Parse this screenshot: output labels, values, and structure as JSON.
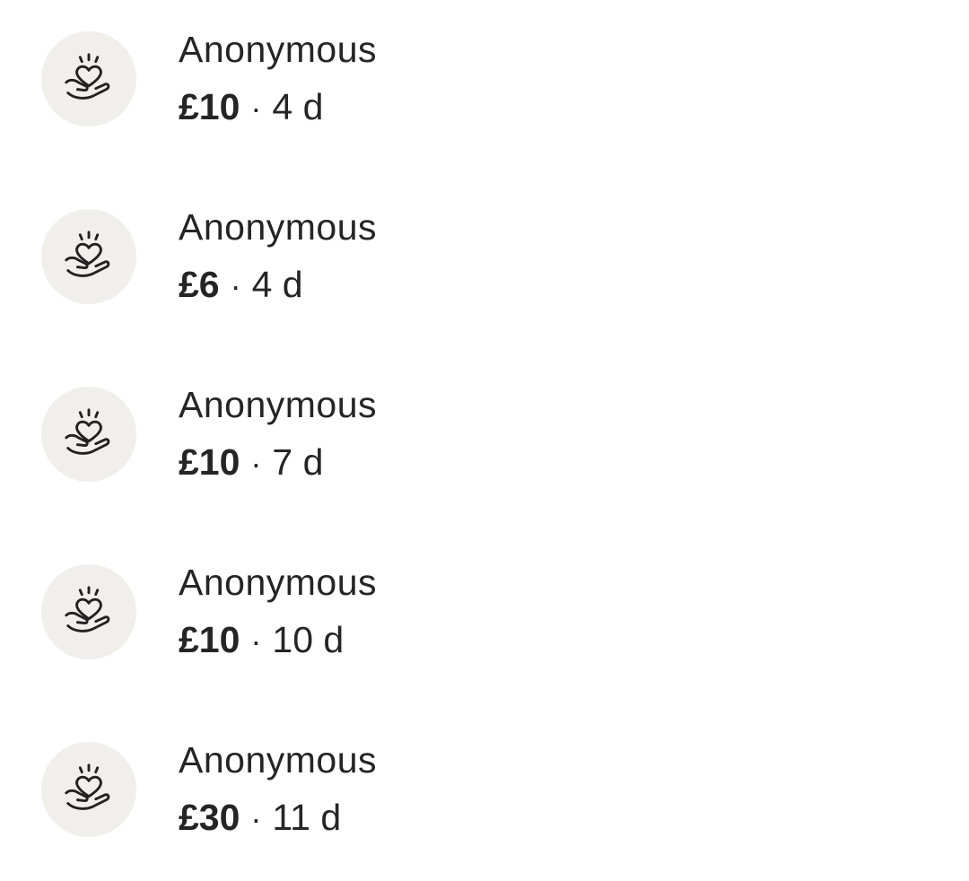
{
  "donations": [
    {
      "icon": "heart-in-hand-icon",
      "name": "Anonymous",
      "amount": "£10",
      "separator": "·",
      "age": "4 d"
    },
    {
      "icon": "heart-in-hand-icon",
      "name": "Anonymous",
      "amount": "£6",
      "separator": "·",
      "age": "4 d"
    },
    {
      "icon": "heart-in-hand-icon",
      "name": "Anonymous",
      "amount": "£10",
      "separator": "·",
      "age": "7 d"
    },
    {
      "icon": "heart-in-hand-icon",
      "name": "Anonymous",
      "amount": "£10",
      "separator": "·",
      "age": "10 d"
    },
    {
      "icon": "heart-in-hand-icon",
      "name": "Anonymous",
      "amount": "£30",
      "separator": "·",
      "age": "11 d"
    }
  ],
  "colors": {
    "avatar_background": "#f1efeb",
    "text": "#252525",
    "page_background": "#ffffff"
  }
}
